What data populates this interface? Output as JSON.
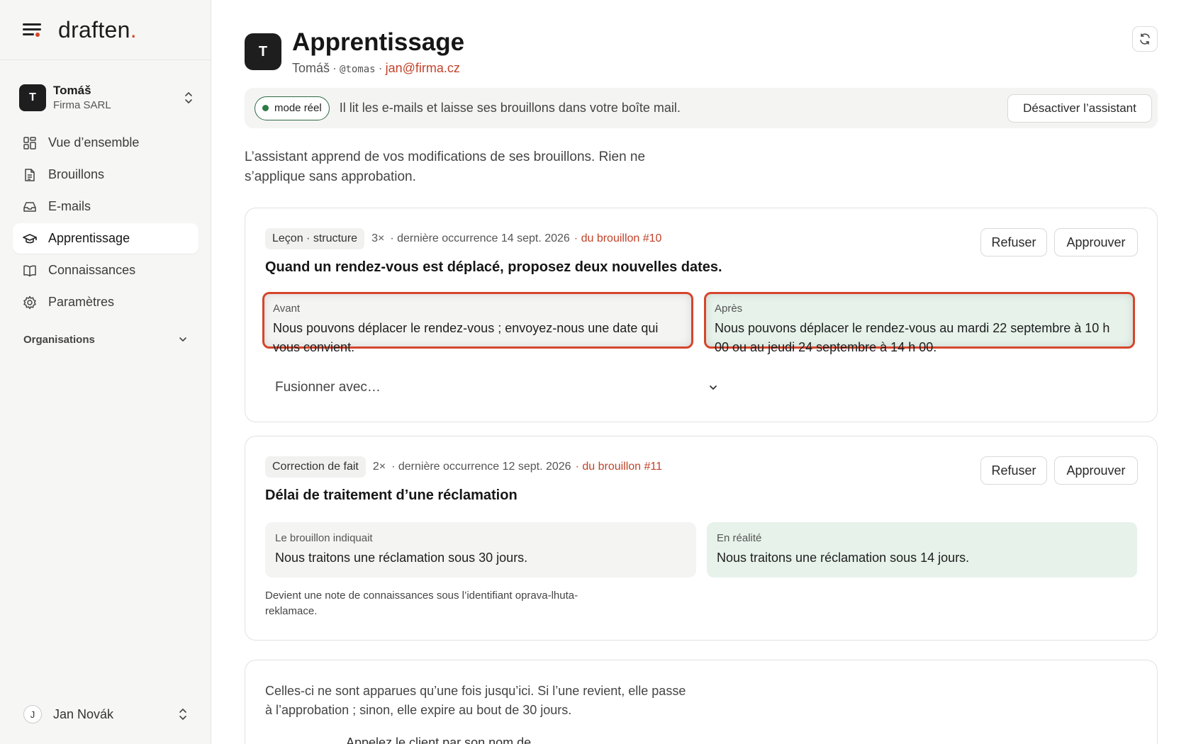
{
  "brand": {
    "name": "draften",
    "dot": ".",
    "accent": "#d6452b"
  },
  "account": {
    "initial": "T",
    "name": "Tomáš",
    "org": "Firma SARL"
  },
  "nav": {
    "items": [
      {
        "label": "Vue d’ensemble",
        "icon": "grid-icon"
      },
      {
        "label": "Brouillons",
        "icon": "document-icon"
      },
      {
        "label": "E-mails",
        "icon": "inbox-icon"
      },
      {
        "label": "Apprentissage",
        "icon": "graduation-cap-icon",
        "active": true
      },
      {
        "label": "Connaissances",
        "icon": "book-icon"
      },
      {
        "label": "Paramètres",
        "icon": "gear-icon"
      }
    ],
    "organisations_label": "Organisations"
  },
  "user": {
    "initial": "J",
    "name": "Jan Novák"
  },
  "header": {
    "initial": "T",
    "title": "Apprentissage",
    "name": "Tomáš",
    "handle": "@tomas",
    "email": "jan@firma.cz",
    "separator": "·"
  },
  "banner": {
    "mode_label": "mode réel",
    "text": "Il lit les e-mails et laisse ses brouillons dans votre boîte mail.",
    "deactivate_label": "Désactiver l’assistant"
  },
  "intro": "L’assistant apprend de vos modifications de ses brouillons. Rien ne s’applique sans approbation.",
  "lessons": [
    {
      "tag": "Leçon · structure",
      "count": "3×",
      "last": "· dernière occurrence 14 sept. 2026",
      "source": "· du brouillon #10",
      "title": "Quand un rendez-vous est déplacé, proposez deux nouvelles dates.",
      "left_label": "Avant",
      "left_text": "Nous pouvons déplacer le rendez-vous ; envoyez-nous une date qui vous convient.",
      "right_label": "Après",
      "right_text": "Nous pouvons déplacer le rendez-vous au mardi 22 septembre à 10 h 00 ou au jeudi 24 septembre à 14 h 00.",
      "merge_placeholder": "Fusionner avec…",
      "refuse_label": "Refuser",
      "approve_label": "Approuver"
    },
    {
      "tag": "Correction de fait",
      "count": "2×",
      "last": "· dernière occurrence 12 sept. 2026",
      "source": "· du brouillon #11",
      "title": "Délai de traitement d’une réclamation",
      "left_label": "Le brouillon indiquait",
      "left_text": "Nous traitons une réclamation sous 30 jours.",
      "right_label": "En réalité",
      "right_text": "Nous traitons une réclamation sous 14 jours.",
      "note": "Devient une note de connaissances sous l’identifiant oprava-lhuta-reklamace.",
      "refuse_label": "Refuser",
      "approve_label": "Approuver"
    }
  ],
  "pending": {
    "text": "Celles-ci ne sont apparues qu’une fois jusqu’ici. Si l’une revient, elle passe à l’approbation ; sinon, elle expire au bout de 30 jours.",
    "next_item": "Appelez le client par son nom de…"
  }
}
